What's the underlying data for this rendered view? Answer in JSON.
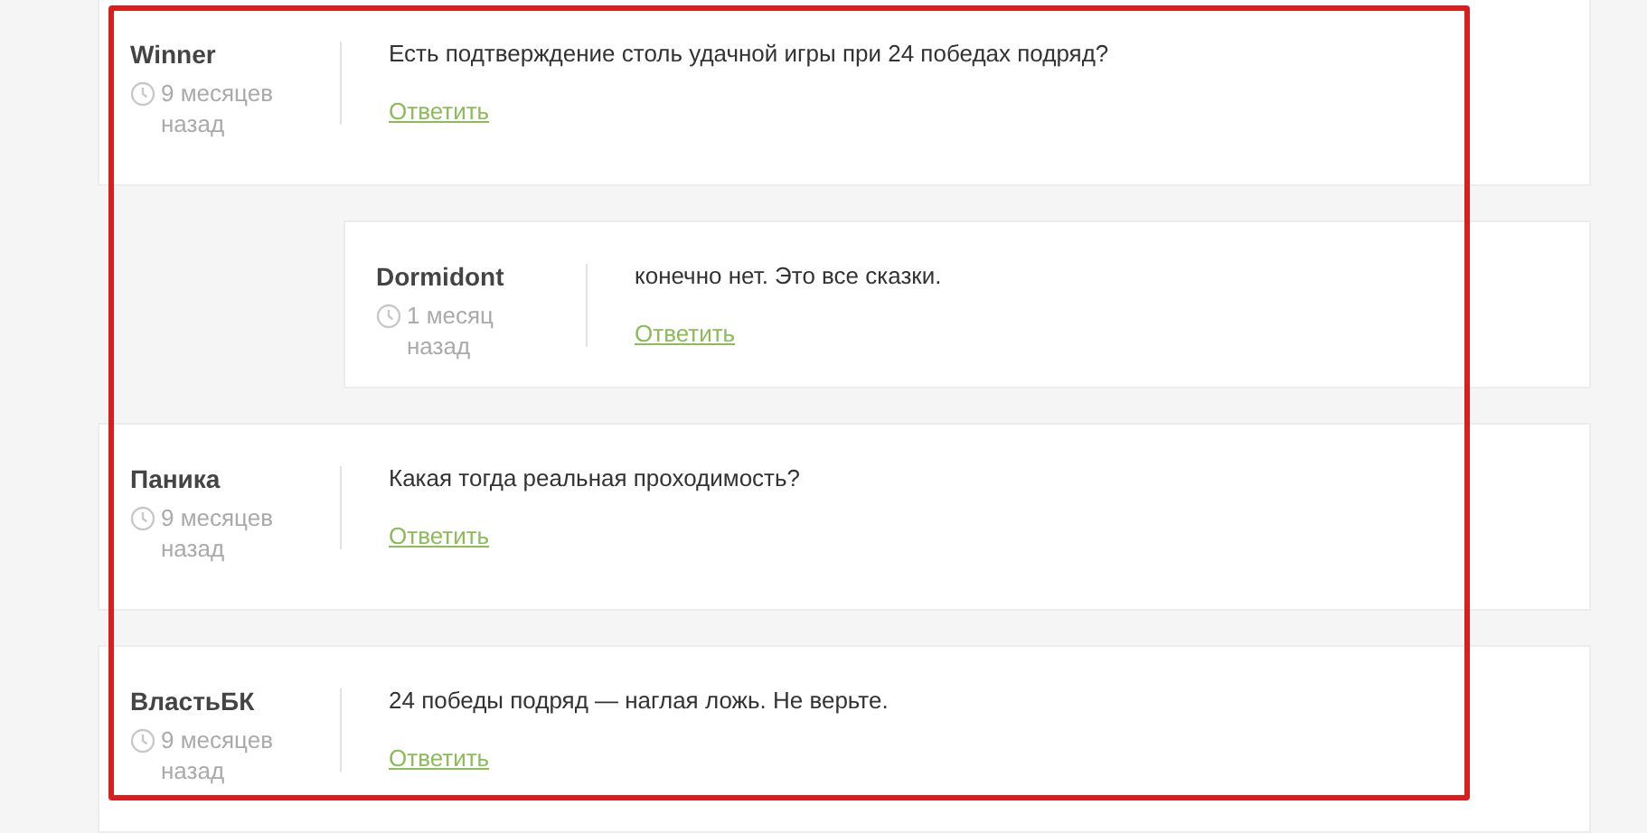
{
  "comments": [
    {
      "author": "Winner",
      "time": "9 месяцев назад",
      "text": "Есть подтверждение столь удачной игры при 24 победах подряд?",
      "reply_link": "Ответить",
      "children": [
        {
          "author": "Dormidont",
          "time": "1 месяц назад",
          "text": "конечно нет. Это все сказки.",
          "reply_link": "Ответить"
        }
      ]
    },
    {
      "author": "Паника",
      "time": "9 месяцев назад",
      "text": "Какая тогда реальная проходимость?",
      "reply_link": "Ответить"
    },
    {
      "author": "ВластьБК",
      "time": "9 месяцев назад",
      "text": "24 победы подряд — наглая ложь. Не верьте.",
      "reply_link": "Ответить"
    }
  ]
}
